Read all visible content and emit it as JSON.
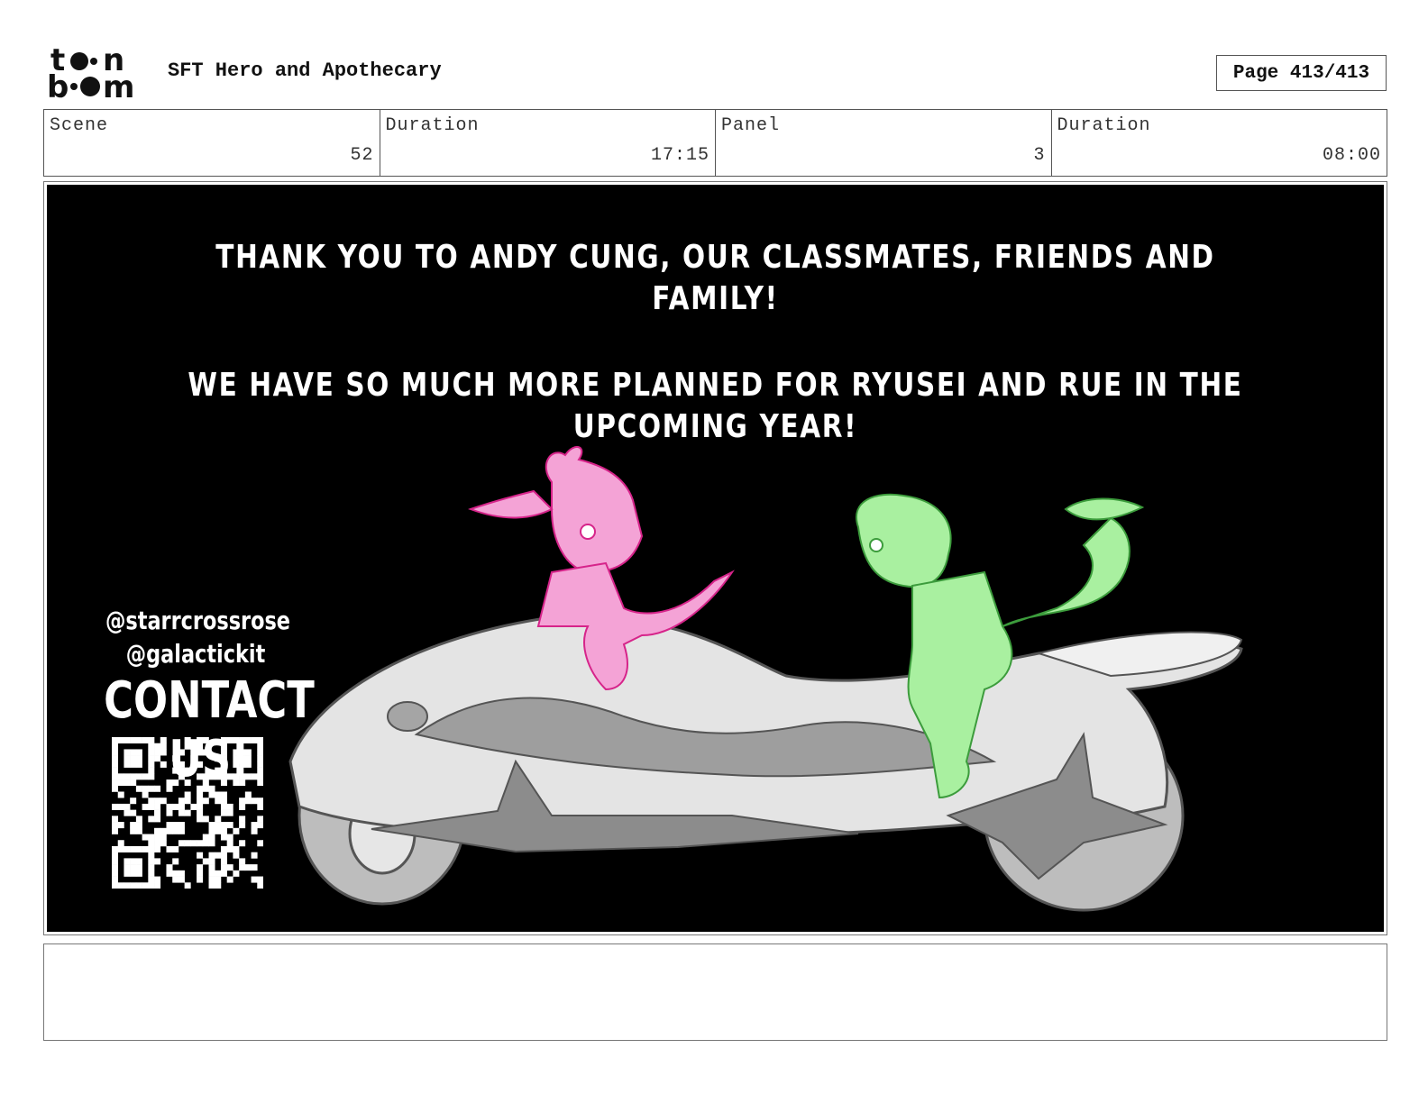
{
  "header": {
    "logo_text": "toon boom",
    "project_title": "SFT Hero and Apothecary",
    "page_label": "Page 413/413"
  },
  "info": {
    "scene_label": "Scene",
    "scene_value": "52",
    "scene_duration_label": "Duration",
    "scene_duration_value": "17:15",
    "panel_label": "Panel",
    "panel_value": "3",
    "panel_duration_label": "Duration",
    "panel_duration_value": "08:00"
  },
  "panel_text": {
    "thanks_line_1": "Thank you to Andy Cung, our classmates, friends and",
    "thanks_line_2": "family!",
    "plans_line_1": "We have so much more planned for Ryusei and Rue in the",
    "plans_line_2": "upcoming year!",
    "handle_1": "@starrcrossrose",
    "handle_2": "@galactickit",
    "contact": "Contact us!"
  },
  "colors": {
    "panel_background": "#000000",
    "pink_character": "#f4a3d6",
    "green_character": "#a9f0a0",
    "bike": "#d9d9d9"
  },
  "notes": {
    "action_notes": ""
  }
}
